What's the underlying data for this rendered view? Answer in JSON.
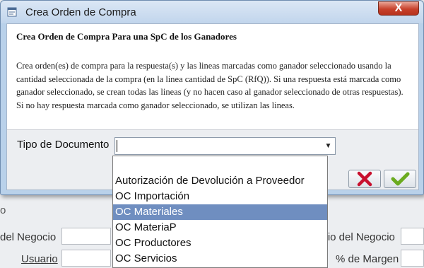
{
  "background": {
    "label_negocio_left": "del Negocio",
    "label_usuario": "Usuario",
    "label_negocio_right": "icio del Negocio",
    "label_margen": "% de Margen",
    "left_fragment": "o"
  },
  "dialog": {
    "title": "Crea Orden de Compra",
    "close_label": "X",
    "heading": "Crea Orden de Compra Para una SpC de los Ganadores",
    "description": "Crea orden(es) de compra para la respuesta(s) y las lineas marcadas como ganador seleccionado usando la cantidad seleccionada de la compra (en la linea cantidad de SpC (RfQ)). Si una respuesta está marcada como ganador seleccionado, se crean todas las lineas (y no hacen caso al ganador seleccionado de otras respuestas). Si no hay respuesta marcada como ganador seleccionado, se utilizan las lineas.",
    "field_label": "Tipo de Documento",
    "field_value": "",
    "cancel_icon": "red-x-icon",
    "ok_icon": "green-check-icon"
  },
  "dropdown": {
    "options": [
      "",
      "Autorización de Devolución a Proveedor",
      "OC Importación",
      "OC Materiales",
      "OC MateriaP",
      "OC Productores",
      "OC Servicios"
    ],
    "selected_index": 3
  },
  "colors": {
    "selection": "#6f8ec0",
    "titlebar": "#c1d5ec",
    "close": "#c7412b"
  }
}
